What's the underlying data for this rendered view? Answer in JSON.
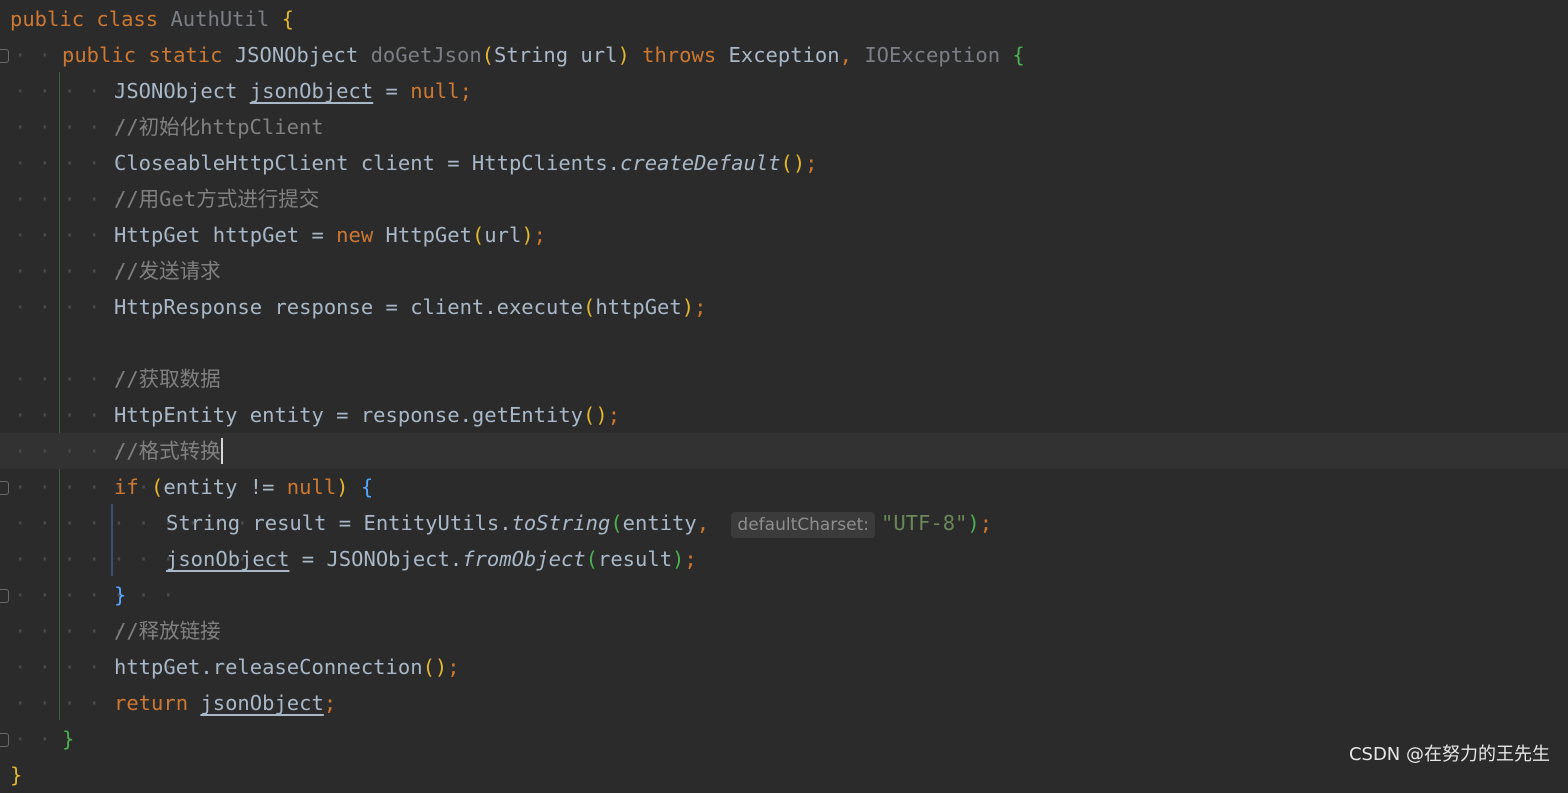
{
  "editor": {
    "lines": [
      {
        "indent": 0,
        "tokens": [
          {
            "t": "public ",
            "c": "kw"
          },
          {
            "t": "class ",
            "c": "kw"
          },
          {
            "t": "AuthUtil ",
            "c": "gr"
          },
          {
            "t": "{",
            "c": "p1"
          }
        ]
      },
      {
        "indent": 1,
        "tokens": [
          {
            "t": "public ",
            "c": "kw"
          },
          {
            "t": "static ",
            "c": "kw"
          },
          {
            "t": "JSONObject ",
            "c": "ty"
          },
          {
            "t": "doGetJson",
            "c": "gr"
          },
          {
            "t": "(",
            "c": "p1"
          },
          {
            "t": "String url",
            "c": "ty"
          },
          {
            "t": ") ",
            "c": "p1"
          },
          {
            "t": "throws ",
            "c": "kw"
          },
          {
            "t": "Exception",
            "c": "ty"
          },
          {
            "t": ", ",
            "c": "pu"
          },
          {
            "t": "IOException ",
            "c": "gr"
          },
          {
            "t": "{",
            "c": "p3"
          }
        ]
      },
      {
        "indent": 2,
        "tokens": [
          {
            "t": "JSONObject ",
            "c": "ty"
          },
          {
            "t": "jsonObject",
            "c": "va"
          },
          {
            "t": " = ",
            "c": "op"
          },
          {
            "t": "null",
            "c": "kw"
          },
          {
            "t": ";",
            "c": "pu"
          }
        ]
      },
      {
        "indent": 2,
        "tokens": [
          {
            "t": "//初始化httpClient",
            "c": "cm"
          }
        ]
      },
      {
        "indent": 2,
        "tokens": [
          {
            "t": "CloseableHttpClient client = HttpClients.",
            "c": "ty"
          },
          {
            "t": "createDefault",
            "c": "it"
          },
          {
            "t": "()",
            "c": "p1"
          },
          {
            "t": ";",
            "c": "pu"
          }
        ]
      },
      {
        "indent": 2,
        "tokens": [
          {
            "t": "//用Get方式进行提交",
            "c": "cm"
          }
        ]
      },
      {
        "indent": 2,
        "tokens": [
          {
            "t": "HttpGet httpGet = ",
            "c": "ty"
          },
          {
            "t": "new ",
            "c": "kw"
          },
          {
            "t": "HttpGet",
            "c": "ty"
          },
          {
            "t": "(",
            "c": "p1"
          },
          {
            "t": "url",
            "c": "ty"
          },
          {
            "t": ")",
            "c": "p1"
          },
          {
            "t": ";",
            "c": "pu"
          }
        ]
      },
      {
        "indent": 2,
        "tokens": [
          {
            "t": "//发送请求",
            "c": "cm"
          }
        ]
      },
      {
        "indent": 2,
        "tokens": [
          {
            "t": "HttpResponse response = client.execute",
            "c": "ty"
          },
          {
            "t": "(",
            "c": "p1"
          },
          {
            "t": "httpGet",
            "c": "ty"
          },
          {
            "t": ")",
            "c": "p1"
          },
          {
            "t": ";",
            "c": "pu"
          }
        ]
      },
      {
        "indent": 0,
        "tokens": []
      },
      {
        "indent": 2,
        "tokens": [
          {
            "t": "//获取数据",
            "c": "cm"
          }
        ]
      },
      {
        "indent": 2,
        "tokens": [
          {
            "t": "HttpEntity entity = response.getEntity",
            "c": "ty"
          },
          {
            "t": "()",
            "c": "p1"
          },
          {
            "t": ";",
            "c": "pu"
          }
        ]
      },
      {
        "indent": 2,
        "current": true,
        "tokens": [
          {
            "t": "//格式转换",
            "c": "cm"
          },
          {
            "t": "",
            "c": "caret"
          }
        ]
      },
      {
        "indent": 2,
        "tokens": [
          {
            "t": "if ",
            "c": "kw"
          },
          {
            "t": "(",
            "c": "p1"
          },
          {
            "t": "entity != ",
            "c": "ty"
          },
          {
            "t": "null",
            "c": "kw"
          },
          {
            "t": ") ",
            "c": "p1"
          },
          {
            "t": "{",
            "c": "p2"
          }
        ]
      },
      {
        "indent": 3,
        "tokens": [
          {
            "t": "String result = EntityUtils.",
            "c": "ty"
          },
          {
            "t": "toString",
            "c": "it"
          },
          {
            "t": "(",
            "c": "p3"
          },
          {
            "t": "entity",
            "c": "ty"
          },
          {
            "t": ", ",
            "c": "pu"
          },
          {
            "t": "defaultCharset:",
            "c": "hint"
          },
          {
            "t": "\"UTF-8\"",
            "c": "st"
          },
          {
            "t": ")",
            "c": "p3"
          },
          {
            "t": ";",
            "c": "pu"
          }
        ]
      },
      {
        "indent": 3,
        "tokens": [
          {
            "t": "jsonObject",
            "c": "va"
          },
          {
            "t": " = JSONObject.",
            "c": "ty"
          },
          {
            "t": "fromObject",
            "c": "it"
          },
          {
            "t": "(",
            "c": "p3"
          },
          {
            "t": "result",
            "c": "ty"
          },
          {
            "t": ")",
            "c": "p3"
          },
          {
            "t": ";",
            "c": "pu"
          }
        ]
      },
      {
        "indent": 2,
        "tokens": [
          {
            "t": "}",
            "c": "p2"
          }
        ]
      },
      {
        "indent": 2,
        "tokens": [
          {
            "t": "//释放链接",
            "c": "cm"
          }
        ]
      },
      {
        "indent": 2,
        "tokens": [
          {
            "t": "httpGet.releaseConnection",
            "c": "ty"
          },
          {
            "t": "()",
            "c": "p1"
          },
          {
            "t": ";",
            "c": "pu"
          }
        ]
      },
      {
        "indent": 2,
        "tokens": [
          {
            "t": "return ",
            "c": "kw"
          },
          {
            "t": "jsonObject",
            "c": "va"
          },
          {
            "t": ";",
            "c": "pu"
          }
        ]
      },
      {
        "indent": 1,
        "tokens": [
          {
            "t": "}",
            "c": "p3"
          }
        ]
      },
      {
        "indent": 0,
        "tokens": [
          {
            "t": "}",
            "c": "p1"
          }
        ]
      }
    ]
  },
  "icons": {
    "intention": "lightbulb-icon",
    "fold": "fold-marker-icon"
  },
  "colors": {
    "background": "#2b2b2b",
    "current_line": "#323232",
    "keyword": "#cc7832",
    "string": "#6a8759",
    "comment": "#808080",
    "text": "#a9b7c6"
  },
  "watermark": "CSDN @在努力的王先生"
}
